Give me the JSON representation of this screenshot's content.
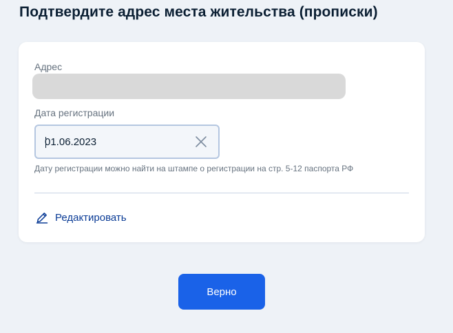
{
  "page": {
    "title": "Подтвердите адрес места жительства (прописки)"
  },
  "form": {
    "address_label": "Адрес",
    "date_label": "Дата регистрации",
    "date_value": "01.06.2023",
    "date_hint": "Дату регистрации можно найти на штампе о регистрации на стр. 5-12 паспорта РФ",
    "edit_label": "Редактировать"
  },
  "actions": {
    "confirm_label": "Верно"
  },
  "icons": {
    "clear": "close-icon",
    "edit": "pencil-icon"
  },
  "colors": {
    "background": "#eef2f7",
    "accent": "#1a62e8",
    "link": "#0b3c96",
    "text": "#0b1f33",
    "muted": "#66727f",
    "input_border": "#b4c6e0",
    "address_redacted": "#d9d9d9"
  }
}
